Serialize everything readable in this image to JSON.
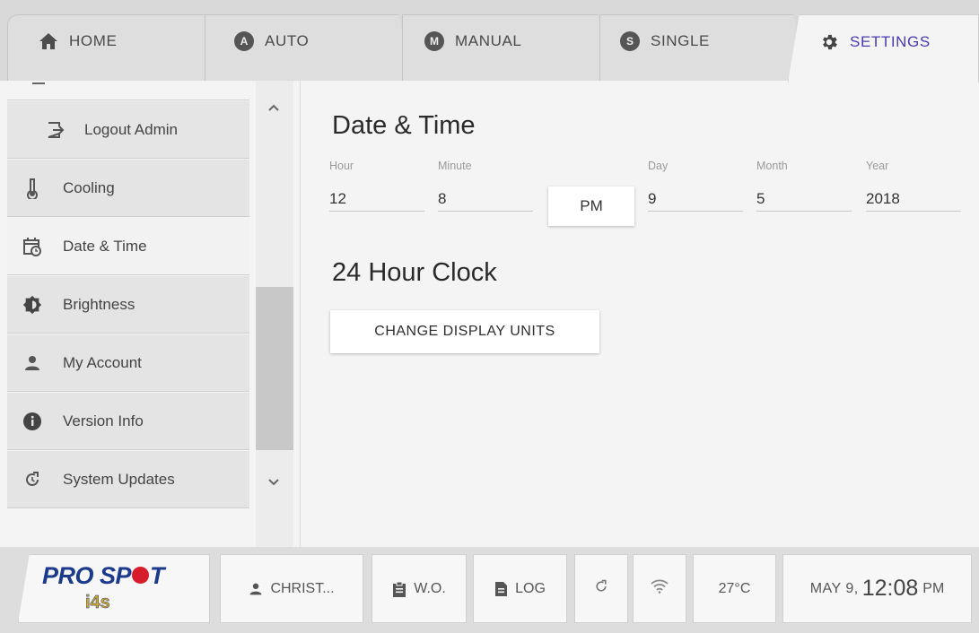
{
  "tabs": {
    "home": {
      "label": "HOME",
      "icon": "home-icon"
    },
    "auto": {
      "label": "AUTO",
      "badge": "A"
    },
    "manual": {
      "label": "MANUAL",
      "badge": "M"
    },
    "single": {
      "label": "SINGLE",
      "badge": "S"
    },
    "settings": {
      "label": "SETTINGS",
      "icon": "gear-icon",
      "active": true
    }
  },
  "sidebar": {
    "items": [
      {
        "label": "Logout Admin",
        "icon": "logout-icon"
      },
      {
        "label": "Cooling",
        "icon": "thermometer-icon"
      },
      {
        "label": "Date & Time",
        "icon": "calendar-clock-icon",
        "active": true
      },
      {
        "label": "Brightness",
        "icon": "brightness-icon"
      },
      {
        "label": "My Account",
        "icon": "person-icon"
      },
      {
        "label": "Version Info",
        "icon": "info-icon"
      },
      {
        "label": "System Updates",
        "icon": "update-icon"
      }
    ]
  },
  "main": {
    "date_time_title": "Date & Time",
    "fields": [
      {
        "label": "Hour",
        "value": "12"
      },
      {
        "label": "Minute",
        "value": "8"
      },
      {
        "label": "Day",
        "value": "9"
      },
      {
        "label": "Month",
        "value": "5"
      },
      {
        "label": "Year",
        "value": "2018"
      }
    ],
    "ampm_button": "PM",
    "clock_title": "24 Hour Clock",
    "change_units_button": "CHANGE DISPLAY UNITS"
  },
  "statusbar": {
    "logo_text_pre": "PRO SP",
    "logo_text_post": "T",
    "logo_sub": "i4s",
    "user": "CHRIST...",
    "wo": "W.O.",
    "log": "LOG",
    "temperature": "27°C",
    "date": "MAY 9,",
    "time": "12:08",
    "ampm": "PM"
  },
  "colors": {
    "accent": "#4a3bb5",
    "logo_blue": "#1c3a8c",
    "logo_red": "#d71c2c",
    "logo_gold": "#d4a91c"
  }
}
